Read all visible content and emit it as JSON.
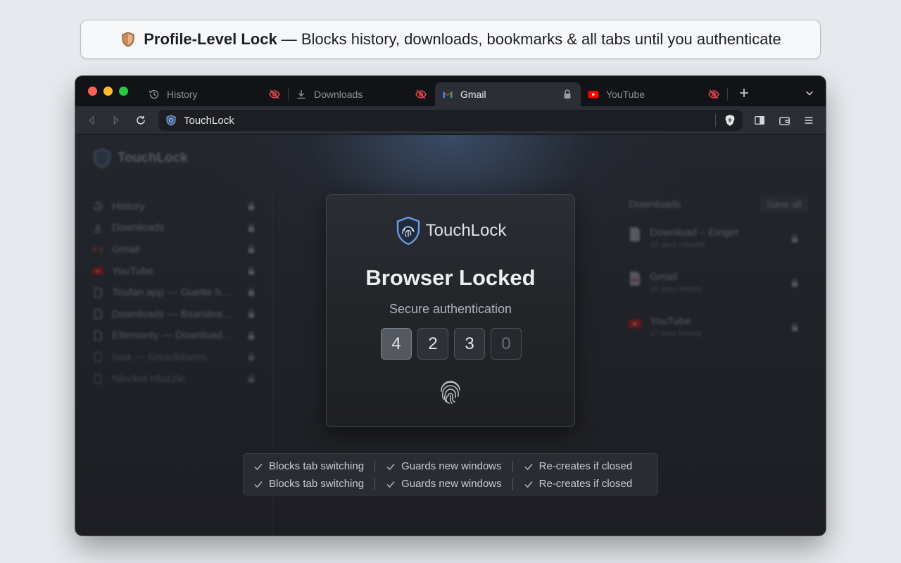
{
  "banner": {
    "bold": "Profile-Level Lock",
    "text": "— Blocks history, downloads, bookmarks & all tabs until you authenticate"
  },
  "tabs": [
    {
      "label": "History",
      "icon": "history-icon",
      "status": "eye-off-icon",
      "active": false
    },
    {
      "label": "Downloads",
      "icon": "download-icon",
      "status": "eye-off-icon",
      "active": false
    },
    {
      "label": "Gmail",
      "icon": "gmail-icon",
      "status": "lock-icon",
      "active": true
    },
    {
      "label": "YouTube",
      "icon": "youtube-icon",
      "status": "eye-off-icon",
      "active": false
    }
  ],
  "toolbar": {
    "url": "TouchLock"
  },
  "background": {
    "brand": "TouchLock",
    "sidebar": [
      {
        "label": "History",
        "icon": "history-icon"
      },
      {
        "label": "Downloads",
        "icon": "download-icon"
      },
      {
        "label": "Gmail",
        "icon": "gmail-icon"
      },
      {
        "label": "YouTube",
        "icon": "youtube-icon"
      },
      {
        "label": "Toufan.app — Guette h...",
        "icon": "page-icon"
      },
      {
        "label": "Downloads — Bsandea...",
        "icon": "page-icon"
      },
      {
        "label": "Eitemonty — Download...",
        "icon": "page-icon"
      },
      {
        "label": "Issa — Gissclolsons",
        "icon": "page-icon"
      },
      {
        "label": "Nlocket Hluzzle",
        "icon": "page-icon"
      }
    ],
    "downloads": {
      "title": "Downloads",
      "save_all": "Save all",
      "items": [
        {
          "title": "Download – Einger",
          "sub": "15 secs nobadd",
          "icon": "file-icon"
        },
        {
          "title": "Gmail",
          "sub": "15 secs history",
          "icon": "gmail-file-icon"
        },
        {
          "title": "YouTube",
          "sub": "17 secs history",
          "icon": "youtube-file-icon"
        }
      ]
    }
  },
  "lock_card": {
    "brand": "TouchLock",
    "title": "Browser Locked",
    "subtitle": "Secure authentication",
    "pin": [
      "4",
      "2",
      "3",
      "0"
    ],
    "fingerprint": "fingerprint-icon"
  },
  "features": {
    "rows": [
      [
        "Blocks tab switching",
        "Guards new windows",
        "Re-creates if closed"
      ],
      [
        "Blocks tab switching",
        "Guards new windows",
        "Re-creates if closed"
      ]
    ]
  },
  "colors": {
    "accent_blue": "#5a8fd6",
    "window_bg": "#1c1d22",
    "tab_active": "#2c2e35",
    "eye_off_red": "#e5484d"
  }
}
